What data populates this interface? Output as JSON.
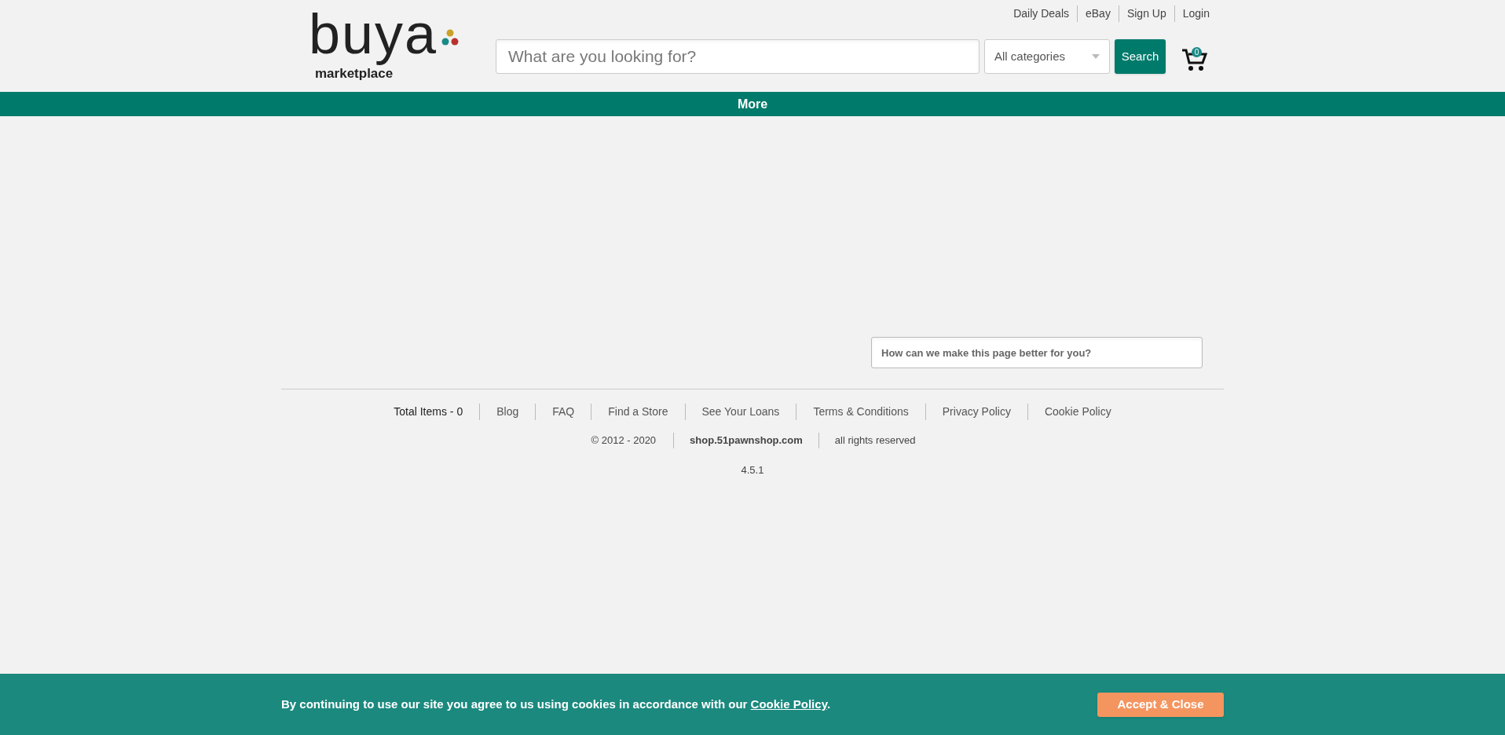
{
  "logo": {
    "wordmark": "buya",
    "tagline": "marketplace"
  },
  "top_links": [
    "Daily Deals",
    "eBay",
    "Sign Up",
    "Login"
  ],
  "search": {
    "placeholder": "What are you looking for?",
    "category": "All categories",
    "button": "Search"
  },
  "cart": {
    "count": "0"
  },
  "nav_bar": {
    "label": "More"
  },
  "feedback": {
    "placeholder": "How can we make this page better for you?"
  },
  "footer": {
    "links": [
      {
        "label": "Total Items - 0",
        "kind": "text"
      },
      {
        "label": "Blog",
        "kind": "link"
      },
      {
        "label": "FAQ",
        "kind": "link"
      },
      {
        "label": "Find a Store",
        "kind": "link"
      },
      {
        "label": "See Your Loans",
        "kind": "link"
      },
      {
        "label": "Terms & Conditions",
        "kind": "link"
      },
      {
        "label": "Privacy Policy",
        "kind": "link"
      },
      {
        "label": "Cookie Policy",
        "kind": "link"
      }
    ],
    "copyright": "© 2012 - 2020",
    "site": "shop.51pawnshop.com",
    "rights": "all rights reserved",
    "version": "4.5.1"
  },
  "cookie_banner": {
    "text": "By continuing to use our site you agree to us using cookies in accordance with our",
    "link": "Cookie Policy",
    "suffix": ".",
    "button": "Accept & Close"
  }
}
